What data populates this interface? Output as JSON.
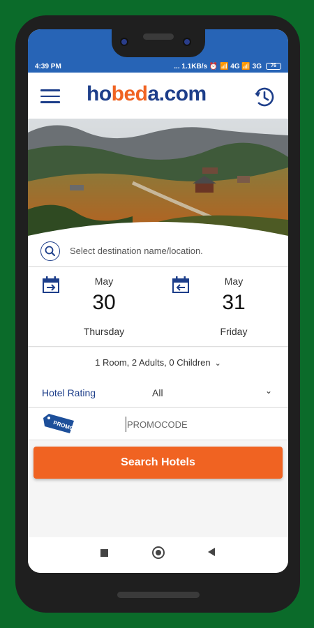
{
  "status": {
    "time": "4:39 PM",
    "indicators": "... 1.1KB/s ⏰ 📶 4G 📶 3G",
    "battery": "76"
  },
  "header": {
    "logo_part1": "ho",
    "logo_part2": "bed",
    "logo_part3": "a.com",
    "menu_icon": "hamburger-icon",
    "history_icon": "history-icon"
  },
  "search": {
    "placeholder": "Select destination name/location."
  },
  "dates": {
    "checkin": {
      "month": "May",
      "day": "30",
      "weekday": "Thursday"
    },
    "checkout": {
      "month": "May",
      "day": "31",
      "weekday": "Friday"
    }
  },
  "rooms": {
    "summary": "1 Room, 2 Adults, 0 Children"
  },
  "rating": {
    "label": "Hotel Rating",
    "value": "All"
  },
  "promo": {
    "tag_text": "PROMO",
    "placeholder": "PROMOCODE"
  },
  "action": {
    "search_label": "Search Hotels"
  },
  "colors": {
    "brand_blue": "#1d3e8a",
    "brand_orange": "#f06322",
    "status_blue": "#2764b6",
    "background_green": "#0b6b2a"
  }
}
